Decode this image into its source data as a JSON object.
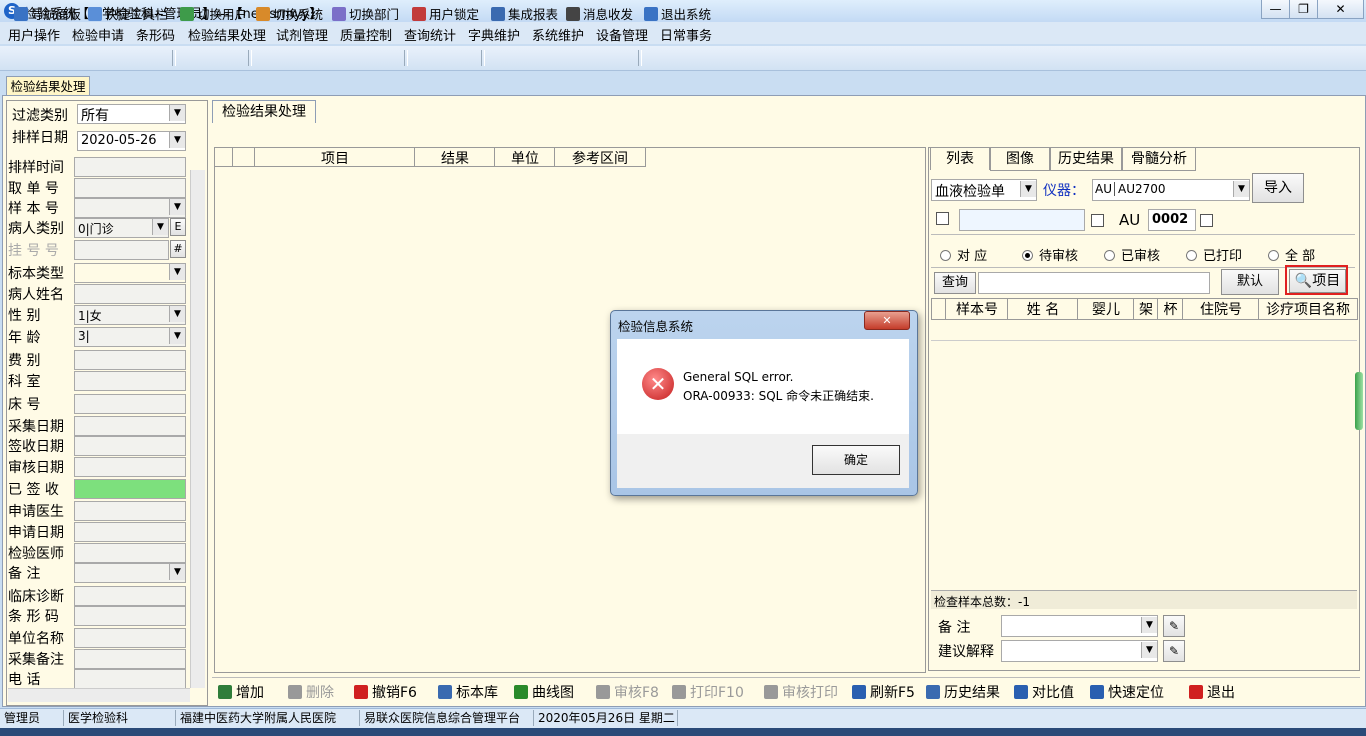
{
  "window": {
    "title": "检验系统【医学检验科--管理员】---【newsrmyy】",
    "min_btn": "—",
    "max_btn": "❐",
    "close_btn": "✕"
  },
  "menu": [
    "用户操作",
    "检验申请",
    "条形码",
    "检验结果处理",
    "试剂管理",
    "质量控制",
    "查询统计",
    "字典维护",
    "系统维护",
    "设备管理",
    "日常事务"
  ],
  "toolbar": [
    "导航面板",
    "快捷工具栏",
    "切换用户",
    "切换系统",
    "切换部门",
    "用户锁定",
    "集成报表",
    "消息收发",
    "退出系统"
  ],
  "doc_tab": "检验结果处理",
  "left_panel": {
    "filter_label": "过滤类别",
    "filter_value": "所有",
    "date_label": "排样日期",
    "date_value": "2020-05-26",
    "fields": [
      {
        "label": "排样时间",
        "value": ""
      },
      {
        "label": "取 单 号",
        "value": ""
      },
      {
        "label": "样 本 号",
        "value": ""
      },
      {
        "label": "病人类别",
        "value": "0|门诊"
      },
      {
        "label": "挂 号 号",
        "value": ""
      },
      {
        "label": "标本类型",
        "value": ""
      },
      {
        "label": "病人姓名",
        "value": ""
      },
      {
        "label": "性    别",
        "value": "1|女"
      },
      {
        "label": "年    龄",
        "value": "3|"
      },
      {
        "label": "费    别",
        "value": ""
      },
      {
        "label": "科    室",
        "value": ""
      },
      {
        "label": "床    号",
        "value": ""
      },
      {
        "label": "采集日期",
        "value": ""
      },
      {
        "label": "签收日期",
        "value": ""
      },
      {
        "label": "审核日期",
        "value": ""
      },
      {
        "label": "已 签 收",
        "value": ""
      },
      {
        "label": "申请医生",
        "value": ""
      },
      {
        "label": "申请日期",
        "value": ""
      },
      {
        "label": "检验医师",
        "value": ""
      },
      {
        "label": "备    注",
        "value": ""
      },
      {
        "label": "临床诊断",
        "value": ""
      },
      {
        "label": "条 形 码",
        "value": ""
      },
      {
        "label": "单位名称",
        "value": ""
      },
      {
        "label": "采集备注",
        "value": ""
      },
      {
        "label": "电    话",
        "value": ""
      }
    ],
    "btn_e": "E",
    "btn_hash": "#"
  },
  "center": {
    "tab": "检验结果处理",
    "columns": [
      "项目",
      "结果",
      "单位",
      "参考区间"
    ]
  },
  "right_panel": {
    "tabs": [
      "列表",
      "图像",
      "历史结果",
      "骨髓分析"
    ],
    "sheet_value": "血液检验单",
    "instrument_label": "仪器：",
    "instrument_code": "AU",
    "instrument_value": "AU2700",
    "import_btn": "导入",
    "au_label": "AU",
    "au_value": "0002",
    "radios": [
      {
        "label": "对 应",
        "checked": false
      },
      {
        "label": "待审核",
        "checked": true
      },
      {
        "label": "已审核",
        "checked": false
      },
      {
        "label": "已打印",
        "checked": false
      },
      {
        "label": "全 部",
        "checked": false
      }
    ],
    "query_btn": "查询",
    "default_btn": "默认",
    "item_btn": "项目",
    "columns": [
      "样本号",
      "姓 名",
      "婴儿",
      "架",
      "杯",
      "住院号",
      "诊疗项目名称"
    ],
    "total_text": "检查样本总数：-1",
    "remark_label": "备    注",
    "advice_label": "建议解释"
  },
  "bottom_toolbar": [
    {
      "label": "增加",
      "enabled": true
    },
    {
      "label": "删除",
      "enabled": false
    },
    {
      "label": "撤销F6",
      "enabled": true
    },
    {
      "label": "标本库",
      "enabled": true
    },
    {
      "label": "曲线图",
      "enabled": true
    },
    {
      "label": "审核F8",
      "enabled": false
    },
    {
      "label": "打印F10",
      "enabled": false
    },
    {
      "label": "审核打印",
      "enabled": false
    },
    {
      "label": "刷新F5",
      "enabled": true
    },
    {
      "label": "历史结果",
      "enabled": true
    },
    {
      "label": "对比值",
      "enabled": true
    },
    {
      "label": "快速定位",
      "enabled": true
    },
    {
      "label": "退出",
      "enabled": true
    }
  ],
  "dialog": {
    "title": "检验信息系统",
    "line1": "General SQL error.",
    "line2": "ORA-00933: SQL 命令未正确结束.",
    "ok": "确定",
    "close": "✕"
  },
  "status": [
    "管理员",
    "医学检验科",
    "福建中医药大学附属人民医院",
    "易联众医院信息综合管理平台",
    "2020年05月26日  星期二"
  ],
  "colors": {
    "accent_green": "#7de07d",
    "highlight_red": "#e02020",
    "error_red": "#d42a2a"
  }
}
